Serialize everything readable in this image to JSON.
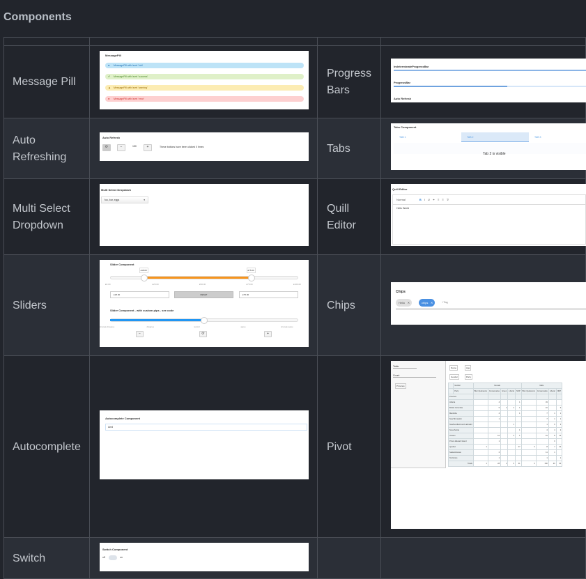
{
  "title": "Components",
  "rows": [
    {
      "left": "Message Pill",
      "right": "Progress Bars"
    },
    {
      "left": "Auto Refreshing",
      "right": "Tabs"
    },
    {
      "left": "Multi Select Dropdown",
      "right": "Quill Editor"
    },
    {
      "left": "Sliders",
      "right": "Chips"
    },
    {
      "left": "Autocomplete",
      "right": "Pivot"
    },
    {
      "left": "Switch",
      "right": ""
    }
  ],
  "message_pill": {
    "title": "MessagePill",
    "pills": [
      {
        "text": "MessagePill with level 'info'",
        "bg": "#bde3f7",
        "fg": "#1f6fb2",
        "icon": "info-icon"
      },
      {
        "text": "MessagePill with level 'success'",
        "bg": "#dff0c8",
        "fg": "#4c8a2a",
        "icon": "check-icon"
      },
      {
        "text": "MessagePill with level 'warning'",
        "bg": "#fcecb3",
        "fg": "#9a6b00",
        "icon": "warning-icon"
      },
      {
        "text": "MessagePill with level 'error'",
        "bg": "#fdd0d0",
        "fg": "#d0312d",
        "icon": "error-icon"
      }
    ]
  },
  "auto_refresh": {
    "title": "Auto Refresh",
    "value": "150",
    "status": "These buttons have been clicked 0 times"
  },
  "multi_select": {
    "title": "Multi Select Dropdown",
    "value": "foo, bar, eggs"
  },
  "sliders": {
    "title": "Slider Component",
    "low_label": "£18.00",
    "high_label": "£75.00",
    "low_pct": 18,
    "high_pct": 75,
    "ticks": [
      "£0.00",
      "£25.00",
      "£50.00",
      "£75.00",
      "£100.00"
    ],
    "low_input": "£18.00",
    "reset": "RESET",
    "high_input": "£75.00",
    "title2": "Slider Component - with custom pips - see code",
    "value2_pct": 50,
    "pips": [
      "strongly disagree",
      "disagree",
      "neutral",
      "agree",
      "strongly agree"
    ]
  },
  "autocomplete": {
    "title": "Autocomplete Component",
    "value": "Amd"
  },
  "switch": {
    "title": "Switch Component",
    "off": "off",
    "on": "on"
  },
  "progress": {
    "title1": "IndeterminateProgressBar",
    "title2": "ProgressBar",
    "value_pct": 50,
    "title3": "Auto Refresh"
  },
  "tabs": {
    "title": "Tabs Component",
    "items": [
      "TAB 1",
      "TAB 2",
      "TAB 3"
    ],
    "active": 1,
    "content": "Tab 2 is visible"
  },
  "quill": {
    "title": "Quill Editor",
    "format": "Normal",
    "content": "Hello World"
  },
  "chips": {
    "title": "Chips",
    "items": [
      "Hello",
      "chips"
    ],
    "placeholder": "+Tag"
  },
  "pivot": {
    "renderer": "Table",
    "aggregator": "Count",
    "cols_fields": [
      "Name",
      "Age"
    ],
    "row_fields": [
      "Gender",
      "Party"
    ],
    "unused": [
      "Province"
    ],
    "col_header": "Gender",
    "row_header": "Party",
    "row_label": "Province",
    "genders": [
      "Female",
      "Male"
    ],
    "parties_female": [
      "Bloc Quebecois",
      "Conservative",
      "Green",
      "Liberal",
      "NDP"
    ],
    "parties_male": [
      "Bloc Quebecois",
      "Conservative",
      "Liberal",
      "NDP"
    ],
    "rows": [
      [
        "Alberta",
        "",
        "4",
        "",
        "",
        "1",
        "",
        "33",
        "",
        ""
      ],
      [
        "British Columbia",
        "",
        "5",
        "1",
        "2",
        "1",
        "",
        "16",
        "",
        "9"
      ],
      [
        "Manitoba",
        "",
        "4",
        "",
        "",
        "1",
        "",
        "7",
        "1",
        "1"
      ],
      [
        "New Brunswick",
        "",
        "1",
        "",
        "",
        "",
        "",
        "7",
        "1",
        "1"
      ],
      [
        "Newfoundland and Labrador",
        "",
        "",
        "",
        "1",
        "",
        "",
        "1",
        "0",
        "3"
      ],
      [
        "Nova Scotia",
        "",
        "",
        "",
        "",
        "1",
        "",
        "4",
        "4",
        "2"
      ],
      [
        "Ontario",
        "",
        "10",
        "",
        "3",
        "1",
        "",
        "61",
        "8",
        "14"
      ],
      [
        "Prince Edward Island",
        "",
        "1",
        "",
        "",
        "",
        "",
        "",
        "0",
        ""
      ],
      [
        "Quebec",
        "1",
        "",
        "",
        "",
        "27",
        "3",
        "8",
        "7",
        "32"
      ],
      [
        "Saskatchewan",
        "",
        "2",
        "",
        "",
        "",
        "",
        "11",
        "1",
        ""
      ],
      [
        "Territories",
        "",
        "1",
        "",
        "",
        "",
        "",
        "1",
        "",
        "1"
      ]
    ],
    "totals_label": "Totals",
    "totals": [
      "1",
      "28",
      "1",
      "6",
      "31",
      "3",
      "150",
      "20",
      "64"
    ]
  }
}
